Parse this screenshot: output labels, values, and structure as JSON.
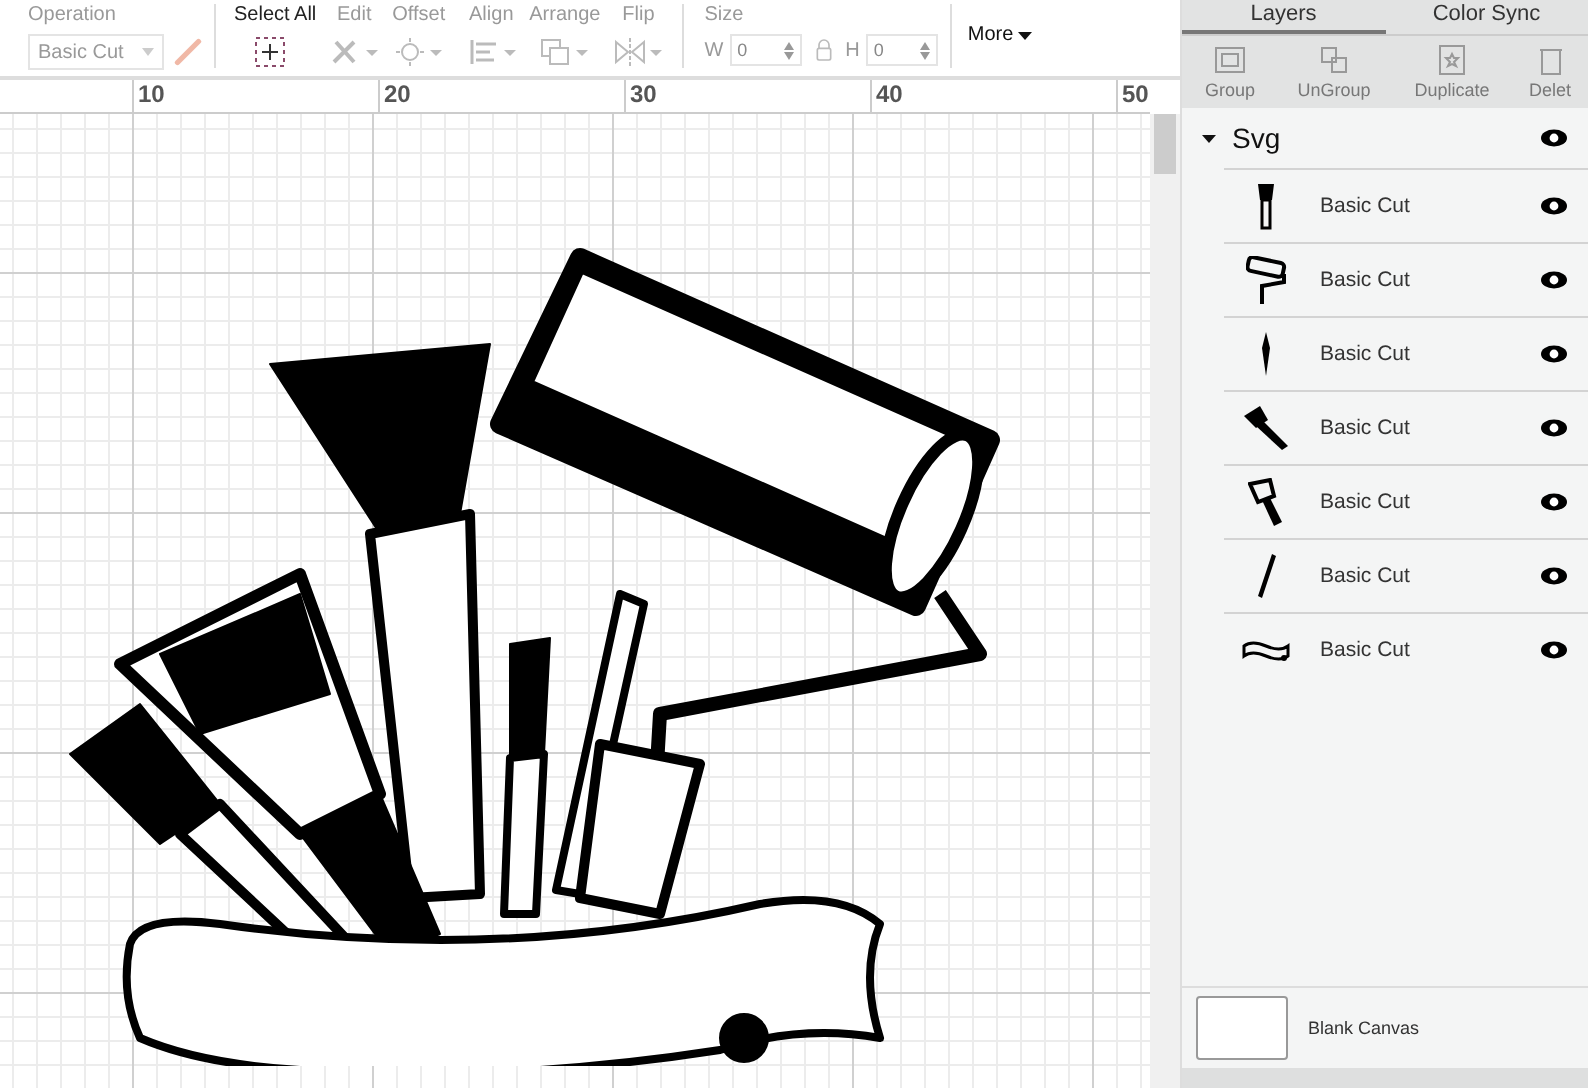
{
  "toolbar": {
    "operation": {
      "label": "Operation",
      "value": "Basic Cut"
    },
    "tools": [
      {
        "label": "Select All",
        "kind": "select",
        "disabled": false
      },
      {
        "label": "Edit",
        "kind": "edit",
        "disabled": true
      },
      {
        "label": "Offset",
        "kind": "offset",
        "disabled": true
      },
      {
        "label": "Align",
        "kind": "align",
        "disabled": true
      },
      {
        "label": "Arrange",
        "kind": "arrange",
        "disabled": true
      },
      {
        "label": "Flip",
        "kind": "flip",
        "disabled": true
      }
    ],
    "size": {
      "label": "Size",
      "width_label": "W",
      "width_value": "0",
      "height_label": "H",
      "height_value": "0"
    },
    "more": "More"
  },
  "ruler": [
    "10",
    "20",
    "30",
    "40",
    "50"
  ],
  "panel": {
    "tabs": [
      {
        "label": "Layers",
        "selected": true
      },
      {
        "label": "Color Sync",
        "selected": false
      }
    ],
    "actions": [
      {
        "label": "Group",
        "kind": "group"
      },
      {
        "label": "UnGroup",
        "kind": "ungroup"
      },
      {
        "label": "Duplicate",
        "kind": "duplicate"
      },
      {
        "label": "Delet",
        "kind": "delete"
      }
    ],
    "group": {
      "name": "Svg",
      "expanded": true,
      "visible": true,
      "children": [
        {
          "name": "Basic Cut",
          "kind": "brush",
          "visible": true
        },
        {
          "name": "Basic Cut",
          "kind": "roller",
          "visible": true
        },
        {
          "name": "Basic Cut",
          "kind": "thin-brush",
          "visible": true
        },
        {
          "name": "Basic Cut",
          "kind": "wide-brush",
          "visible": true
        },
        {
          "name": "Basic Cut",
          "kind": "scraper",
          "visible": true
        },
        {
          "name": "Basic Cut",
          "kind": "pencil-brush",
          "visible": true
        },
        {
          "name": "Basic Cut",
          "kind": "banner",
          "visible": true
        }
      ]
    },
    "canvas_label": "Blank Canvas"
  }
}
